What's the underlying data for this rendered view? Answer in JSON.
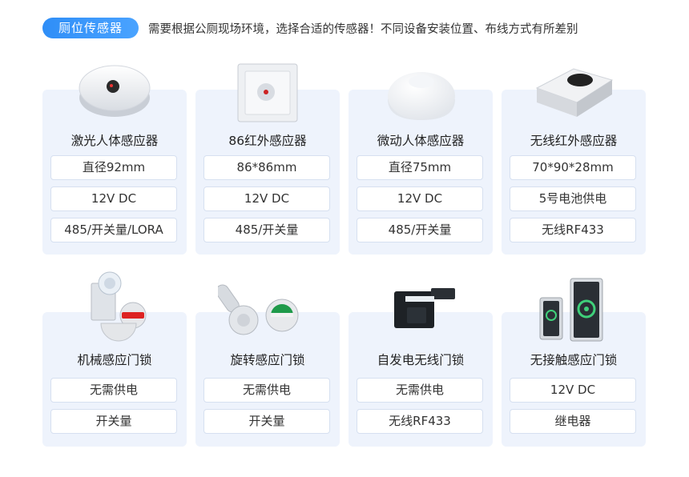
{
  "header": {
    "badge": "厕位传感器",
    "description": "需要根据公厕现场环境，选择合适的传感器！不同设备安装位置、布线方式有所差别"
  },
  "row1": [
    {
      "title": "激光人体感应器",
      "specs": [
        "直径92mm",
        "12V DC",
        "485/开关量/LORA"
      ],
      "icon": "round-laser-sensor-icon"
    },
    {
      "title": "86红外感应器",
      "specs": [
        "86*86mm",
        "12V DC",
        "485/开关量"
      ],
      "icon": "square-ir-sensor-icon"
    },
    {
      "title": "微动人体感应器",
      "specs": [
        "直径75mm",
        "12V DC",
        "485/开关量"
      ],
      "icon": "dome-sensor-icon"
    },
    {
      "title": "无线红外感应器",
      "specs": [
        "70*90*28mm",
        "5号电池供电",
        "无线RF433"
      ],
      "icon": "wireless-ir-sensor-icon"
    }
  ],
  "row2": [
    {
      "title": "机械感应门锁",
      "specs": [
        "无需供电",
        "开关量"
      ],
      "icon": "mechanical-lock-icon"
    },
    {
      "title": "旋转感应门锁",
      "specs": [
        "无需供电",
        "开关量"
      ],
      "icon": "rotary-lock-icon"
    },
    {
      "title": "自发电无线门锁",
      "specs": [
        "无需供电",
        "无线RF433"
      ],
      "icon": "self-powered-lock-icon"
    },
    {
      "title": "无接触感应门锁",
      "specs": [
        "12V DC",
        "继电器"
      ],
      "icon": "touchless-switch-icon"
    }
  ]
}
